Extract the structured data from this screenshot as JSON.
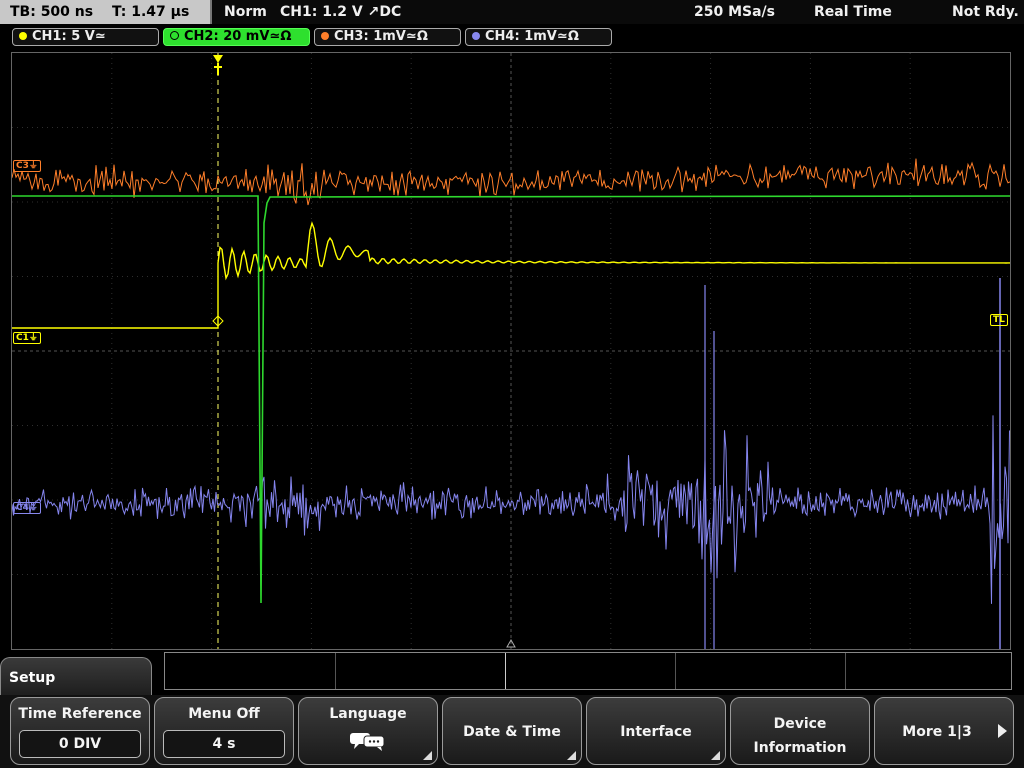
{
  "status_bar": {
    "timebase": "TB: 500 ns",
    "trigger_time": "T: 1.47 µs",
    "mode": "Norm",
    "trigger": "CH1: 1.2 V ↗DC",
    "sample_rate": "250 MSa/s",
    "acq_mode": "Real Time",
    "state": "Not Rdy."
  },
  "channels": [
    {
      "label": "CH1: 5 V≃",
      "color": "#ffff00",
      "active": false
    },
    {
      "label": "CH2: 20 mV≃Ω",
      "color": "#2ee02e",
      "active": true
    },
    {
      "label": "CH3: 1mV≃Ω",
      "color": "#ff7f2a",
      "active": false
    },
    {
      "label": "CH4: 1mV≃Ω",
      "color": "#8888ee",
      "active": false
    }
  ],
  "markers": {
    "c3": "C3⏚",
    "c1": "C1⏚",
    "c4": "C4⏚",
    "trigger_level": "TL",
    "trigger_pos": "T"
  },
  "menu": {
    "title": "Setup",
    "softkeys": [
      {
        "label": "Time Reference",
        "value": "0 DIV"
      },
      {
        "label": "Menu Off",
        "value": "4 s"
      },
      {
        "label": "Language",
        "icon": "speech-bubbles-icon"
      },
      {
        "label": "Date & Time"
      },
      {
        "label": "Interface"
      },
      {
        "label": "Device Information"
      },
      {
        "label": "More 1|3"
      }
    ]
  }
}
